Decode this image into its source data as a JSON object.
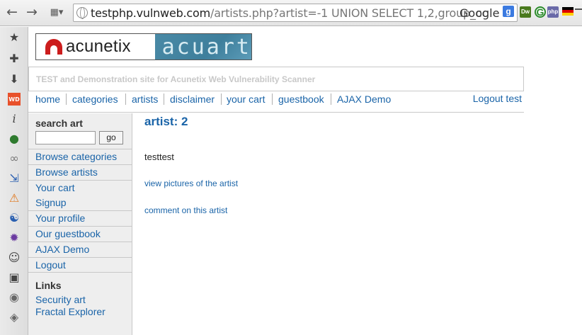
{
  "browser": {
    "url_host": "testphp.vulnweb.com",
    "url_path": "/artists.php?artist=-1 UNION SELECT 1,2,group_cc",
    "search_engine": "Google",
    "google_icon_letter": "g",
    "extensions": {
      "dw": "Dw",
      "g": "G",
      "php": "php"
    }
  },
  "logo": {
    "left_text": "acunetix",
    "right_text": "acuart"
  },
  "tagline": "TEST and Demonstration site for Acunetix Web Vulnerability Scanner",
  "topnav": {
    "items": [
      "home",
      "categories",
      "artists",
      "disclaimer",
      "your cart",
      "guestbook",
      "AJAX Demo"
    ],
    "logout": "Logout test"
  },
  "sidebar": {
    "search_title": "search art",
    "search_value": "",
    "go_label": "go",
    "items": [
      "Browse categories",
      "Browse artists",
      "Your cart",
      "Signup",
      "Your profile",
      "Our guestbook",
      "AJAX Demo",
      "Logout"
    ],
    "links_title": "Links",
    "links": [
      "Security art",
      "Fractal Explorer"
    ]
  },
  "content": {
    "title": "artist: 2",
    "artist_name": "testtest",
    "view_pictures": "view pictures of the artist",
    "comment": "comment on this artist"
  }
}
